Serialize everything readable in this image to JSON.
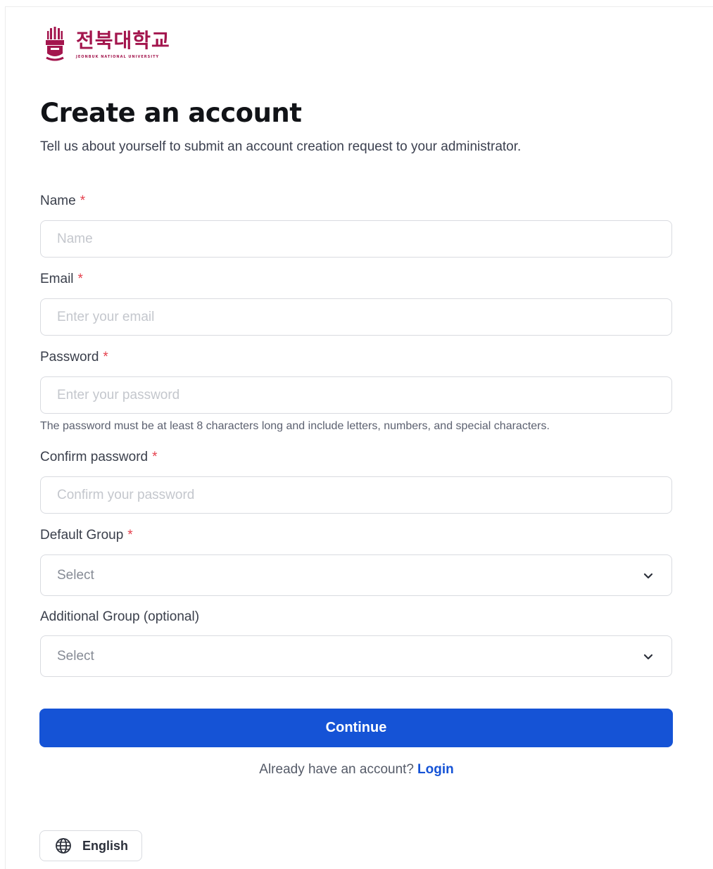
{
  "brand": {
    "name_ko": "전북대학교",
    "name_en": "JEONBUK NATIONAL UNIVERSITY",
    "color": "#a3154d"
  },
  "header": {
    "title": "Create an account",
    "subtitle": "Tell us about yourself to submit an account creation request to your administrator."
  },
  "form": {
    "required_mark": "*",
    "name": {
      "label": "Name",
      "placeholder": "Name",
      "value": ""
    },
    "email": {
      "label": "Email",
      "placeholder": "Enter your email",
      "value": ""
    },
    "password": {
      "label": "Password",
      "placeholder": "Enter your password",
      "value": "",
      "hint": "The password must be at least 8 characters long and include letters, numbers, and special characters."
    },
    "confirm_password": {
      "label": "Confirm password",
      "placeholder": "Confirm your password",
      "value": ""
    },
    "default_group": {
      "label": "Default Group",
      "selected": "Select",
      "icon": "chevron-down-icon"
    },
    "additional_group": {
      "label": "Additional Group (optional)",
      "selected": "Select",
      "icon": "chevron-down-icon"
    }
  },
  "actions": {
    "continue_label": "Continue",
    "continue_color": "#1553d6",
    "already_text": "Already have an account?",
    "login_label": "Login"
  },
  "footer": {
    "language_label": "English",
    "language_icon": "globe-icon"
  }
}
